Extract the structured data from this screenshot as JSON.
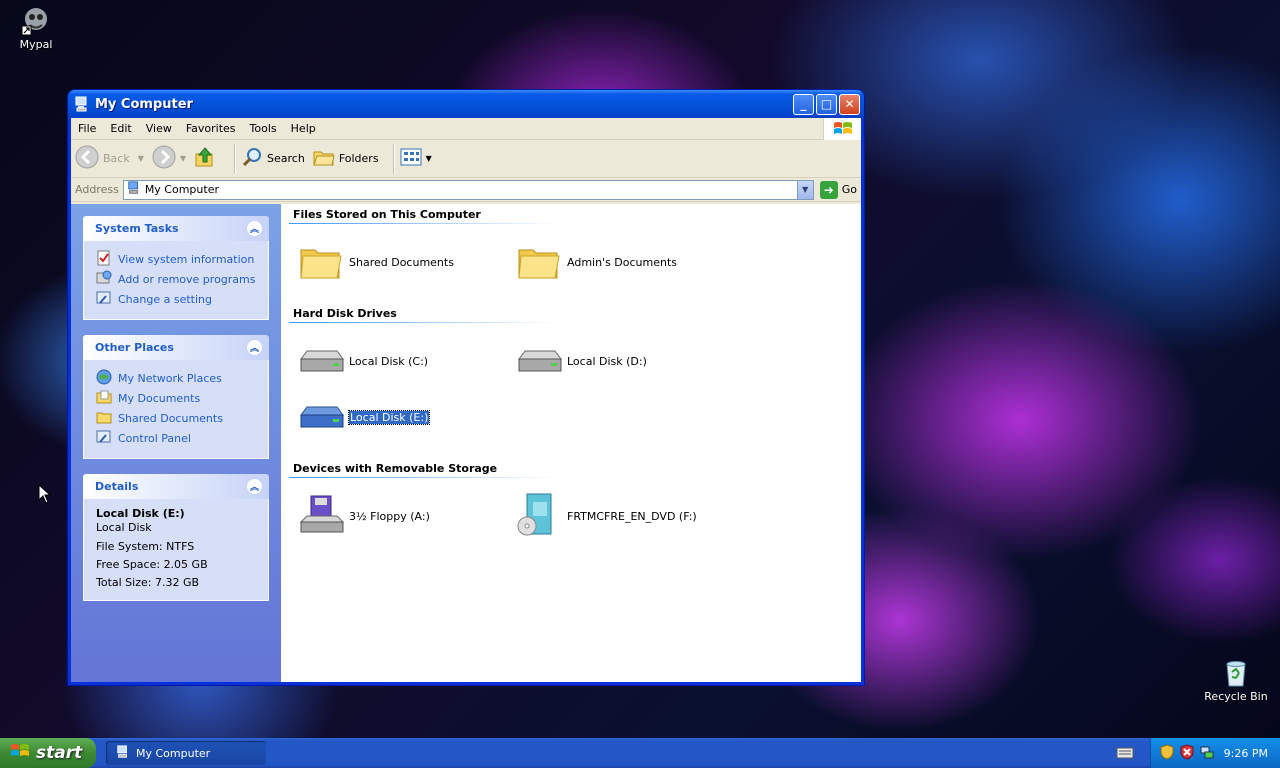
{
  "desktop": {
    "icons": [
      {
        "label": "Mypal"
      },
      {
        "label": "Recycle Bin"
      }
    ]
  },
  "window": {
    "title": "My Computer",
    "menu": [
      "File",
      "Edit",
      "View",
      "Favorites",
      "Tools",
      "Help"
    ],
    "toolbar": {
      "back": "Back",
      "search": "Search",
      "folders": "Folders"
    },
    "address": {
      "label": "Address",
      "value": "My Computer",
      "go": "Go"
    }
  },
  "sidebar": {
    "system_tasks": {
      "title": "System Tasks",
      "items": [
        "View system information",
        "Add or remove programs",
        "Change a setting"
      ]
    },
    "other_places": {
      "title": "Other Places",
      "items": [
        "My Network Places",
        "My Documents",
        "Shared Documents",
        "Control Panel"
      ]
    },
    "details": {
      "title": "Details",
      "name": "Local Disk (E:)",
      "type": "Local Disk",
      "file_system": "File System: NTFS",
      "free_space": "Free Space: 2.05 GB",
      "total_size": "Total Size: 7.32 GB"
    }
  },
  "main": {
    "groups": {
      "files": {
        "title": "Files Stored on This Computer",
        "items": [
          "Shared Documents",
          "Admin's Documents"
        ]
      },
      "drives": {
        "title": "Hard Disk Drives",
        "items": [
          "Local Disk (C:)",
          "Local Disk (D:)",
          "Local Disk (E:)"
        ]
      },
      "removable": {
        "title": "Devices with Removable Storage",
        "items": [
          "3½ Floppy (A:)",
          "FRTMCFRE_EN_DVD (F:)"
        ]
      }
    },
    "selected_item": "Local Disk (E:)"
  },
  "taskbar": {
    "start": "start",
    "window_button": "My Computer",
    "clock": "9:26 PM"
  }
}
